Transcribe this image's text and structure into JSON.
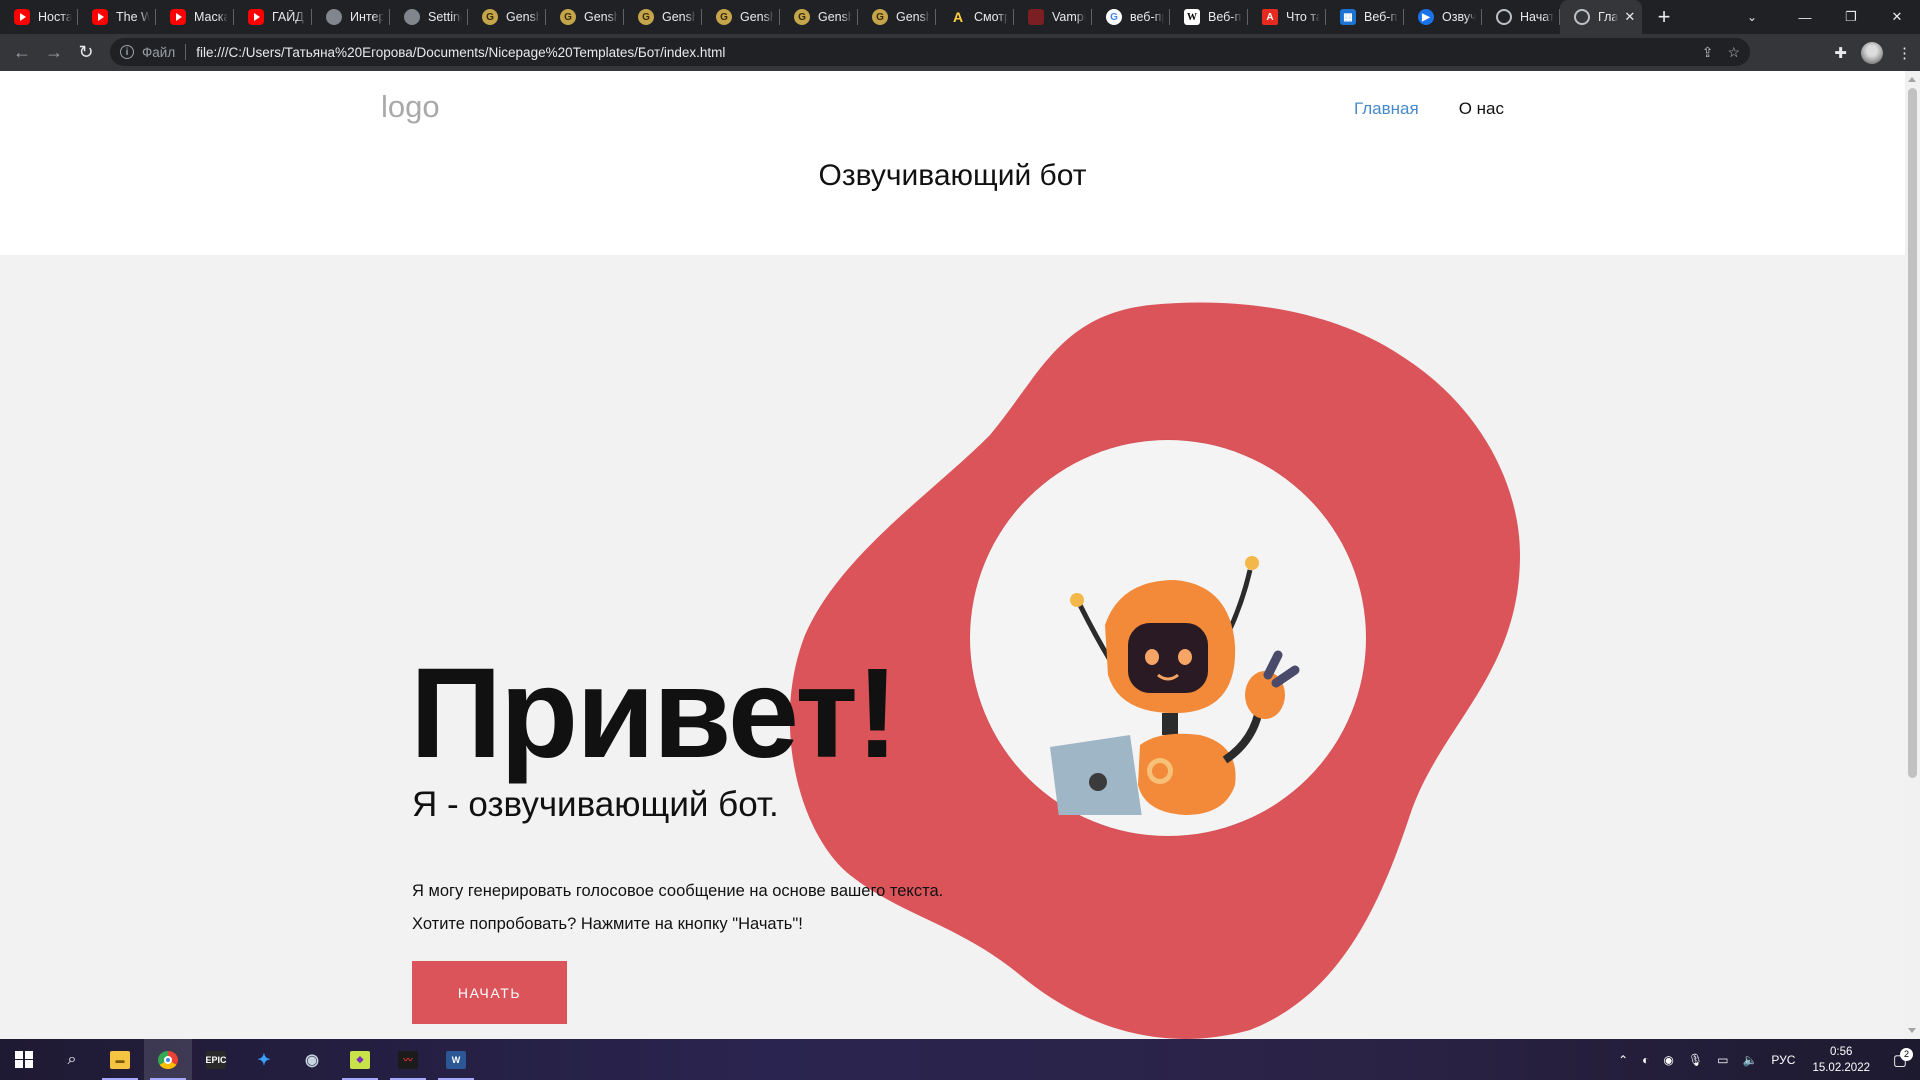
{
  "browser": {
    "tabs": [
      {
        "title": "Ностал",
        "icon": "youtube-icon"
      },
      {
        "title": "The Wi",
        "icon": "youtube-icon"
      },
      {
        "title": "Маска",
        "icon": "youtube-icon"
      },
      {
        "title": "ГАЙД |",
        "icon": "youtube-icon"
      },
      {
        "title": "Интер",
        "icon": "leaf-icon"
      },
      {
        "title": "Setting",
        "icon": "paw-icon"
      },
      {
        "title": "Genshi",
        "icon": "genshin-icon"
      },
      {
        "title": "Genshi",
        "icon": "genshin-icon"
      },
      {
        "title": "Genshi",
        "icon": "genshin-icon"
      },
      {
        "title": "Genshi",
        "icon": "genshin-icon"
      },
      {
        "title": "Genshi",
        "icon": "genshin-icon"
      },
      {
        "title": "Genshi",
        "icon": "genshin-icon"
      },
      {
        "title": "Смотр",
        "icon": "a-icon"
      },
      {
        "title": "Vampir",
        "icon": "vampire-icon"
      },
      {
        "title": "веб-пр",
        "icon": "google-icon"
      },
      {
        "title": "Веб-пр",
        "icon": "wikipedia-icon"
      },
      {
        "title": "Что та",
        "icon": "adobe-icon"
      },
      {
        "title": "Веб-пр",
        "icon": "grid-icon"
      },
      {
        "title": "Озвуч",
        "icon": "play-icon"
      },
      {
        "title": "Начать",
        "icon": "globe-icon"
      }
    ],
    "active_tab": {
      "title": "Гла",
      "icon": "globe-icon"
    },
    "address": {
      "scheme_label": "Файл",
      "url": "file:///C:/Users/Татьяна%20Егорова/Documents/Nicepage%20Templates/Бот/index.html"
    }
  },
  "site": {
    "logo": "logo",
    "nav": {
      "home": "Главная",
      "about": "О нас"
    },
    "page_title": "Озвучивающий бот",
    "hero": {
      "title": "Привет!",
      "subtitle": "Я - озвучивающий бот.",
      "line1": "Я могу генерировать голосовое сообщение на основе вашего текста.",
      "line2": "Хотите попробовать? Нажмите на кнопку \"Начать\"!",
      "button": "НАЧАТЬ"
    },
    "colors": {
      "accent": "#db545a",
      "link": "#478ac9",
      "hero_bg": "#f2f2f2"
    }
  },
  "taskbar": {
    "apps": [
      "start-icon",
      "search-icon",
      "file-explorer-icon",
      "chrome-icon",
      "epic-games-icon",
      "battlenet-icon",
      "steam-icon",
      "game-launcher-icon",
      "msi-afterburner-icon",
      "word-icon"
    ],
    "tray": {
      "language": "РУС",
      "time": "0:56",
      "date": "15.02.2022",
      "notifications": "2"
    }
  }
}
